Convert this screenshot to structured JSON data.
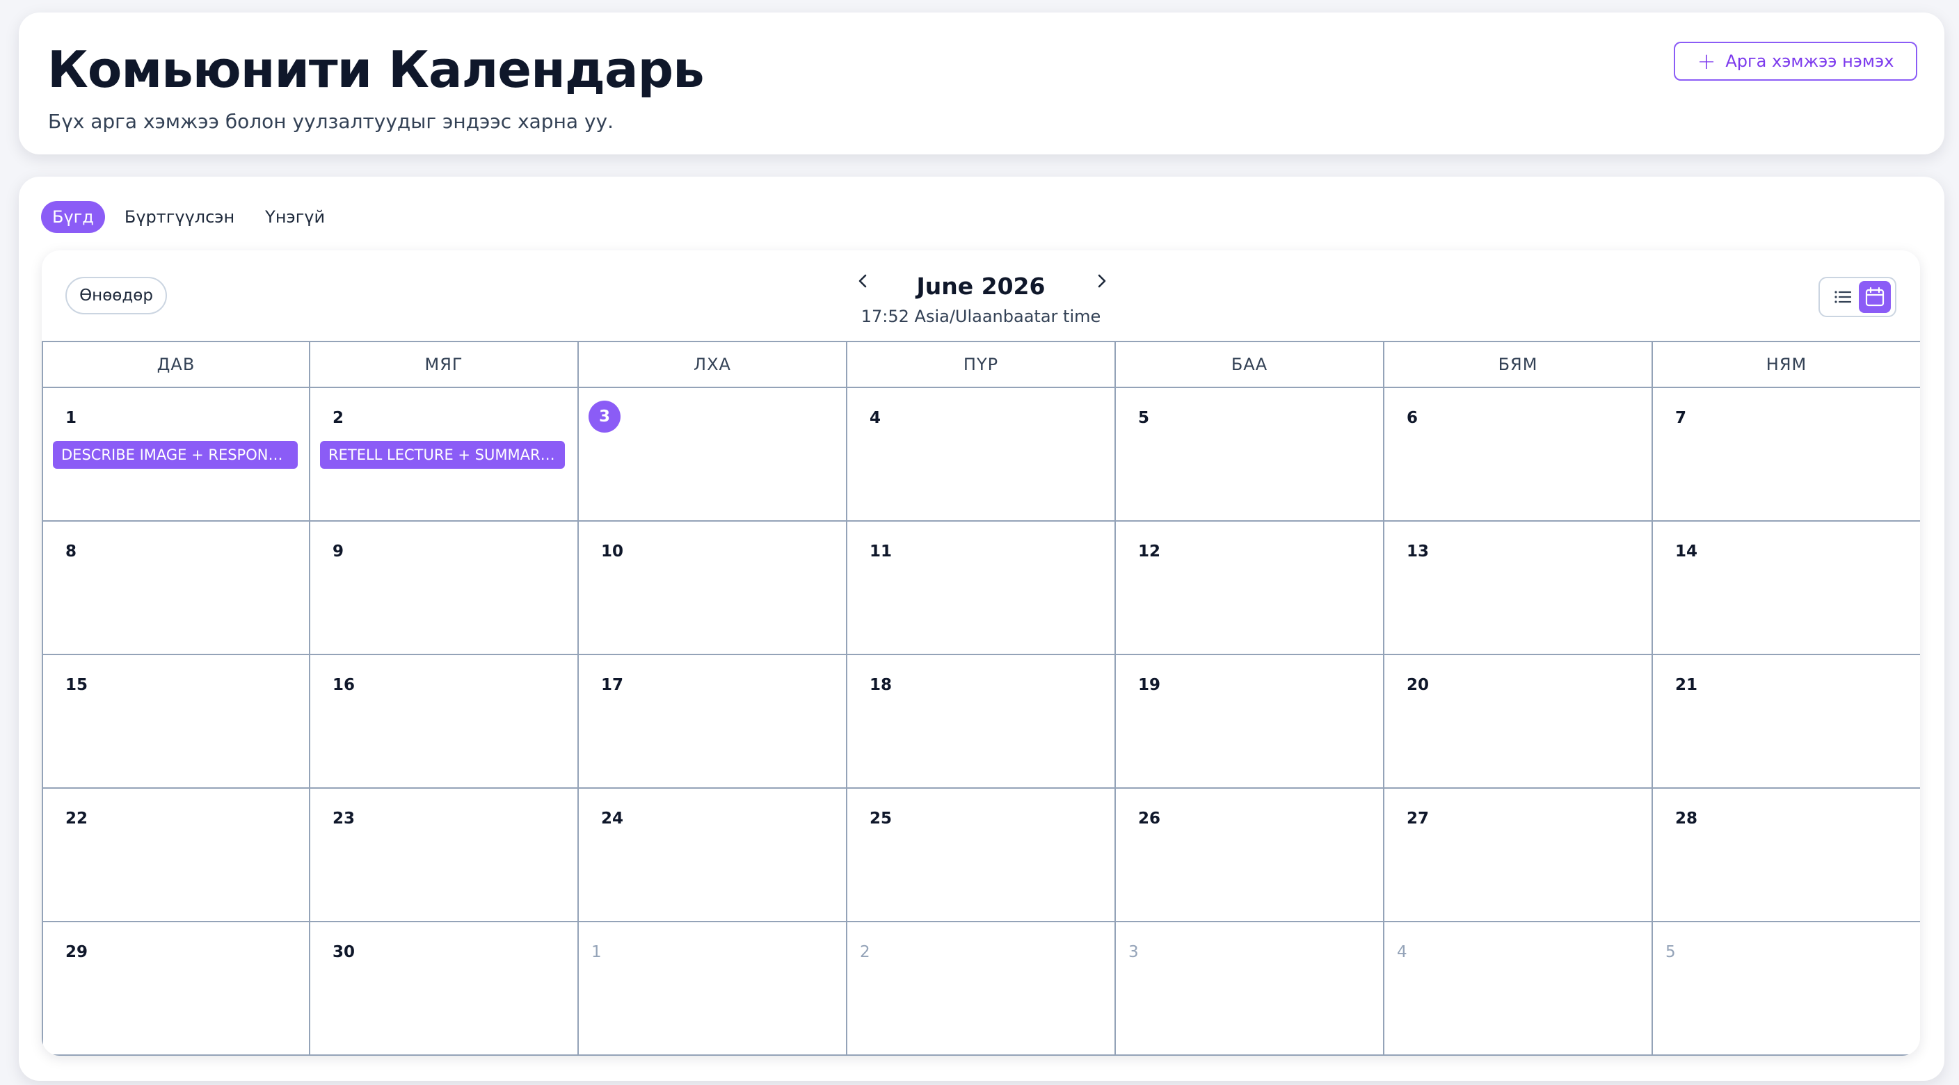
{
  "header": {
    "title": "Комьюнити Календарь",
    "subtitle": "Бүх арга хэмжээ болон уулзалтуудыг эндээс харна уу.",
    "add_event_label": "Арга хэмжээ нэмэх"
  },
  "filters": [
    {
      "label": "Бүгд",
      "active": true
    },
    {
      "label": "Бүртгүүлсэн",
      "active": false
    },
    {
      "label": "Үнэгүй",
      "active": false
    }
  ],
  "calendar": {
    "today_label": "Өнөөдөр",
    "month_title": "June 2026",
    "timezone": "17:52 Asia/Ulaanbaatar time",
    "weekdays": [
      "ДАВ",
      "МЯГ",
      "ЛХА",
      "ПҮР",
      "БАА",
      "БЯМ",
      "НЯМ"
    ],
    "today_day": 3,
    "weeks": [
      [
        {
          "d": "1"
        },
        {
          "d": "2"
        },
        {
          "d": "3"
        },
        {
          "d": "4"
        },
        {
          "d": "5"
        },
        {
          "d": "6"
        },
        {
          "d": "7"
        }
      ],
      [
        {
          "d": "8"
        },
        {
          "d": "9"
        },
        {
          "d": "10"
        },
        {
          "d": "11"
        },
        {
          "d": "12"
        },
        {
          "d": "13"
        },
        {
          "d": "14"
        }
      ],
      [
        {
          "d": "15"
        },
        {
          "d": "16"
        },
        {
          "d": "17"
        },
        {
          "d": "18"
        },
        {
          "d": "19"
        },
        {
          "d": "20"
        },
        {
          "d": "21"
        }
      ],
      [
        {
          "d": "22"
        },
        {
          "d": "23"
        },
        {
          "d": "24"
        },
        {
          "d": "25"
        },
        {
          "d": "26"
        },
        {
          "d": "27"
        },
        {
          "d": "28"
        }
      ],
      [
        {
          "d": "29"
        },
        {
          "d": "30"
        },
        {
          "d": "1",
          "other": true
        },
        {
          "d": "2",
          "other": true
        },
        {
          "d": "3",
          "other": true
        },
        {
          "d": "4",
          "other": true
        },
        {
          "d": "5",
          "other": true
        }
      ]
    ],
    "events": [
      {
        "day": "1",
        "title": "DESCRIBE IMAGE + RESPOND..."
      },
      {
        "day": "2",
        "title": "RETELL LECTURE + SUMMARI..."
      }
    ]
  },
  "colors": {
    "accent": "#8b5cf6",
    "grid_line": "#94a3b8",
    "background": "#f4f5f9"
  },
  "icons": {
    "add": "plus-icon",
    "prev": "chevron-left-icon",
    "next": "chevron-right-icon",
    "list_view": "list-icon",
    "calendar_view": "calendar-icon"
  }
}
